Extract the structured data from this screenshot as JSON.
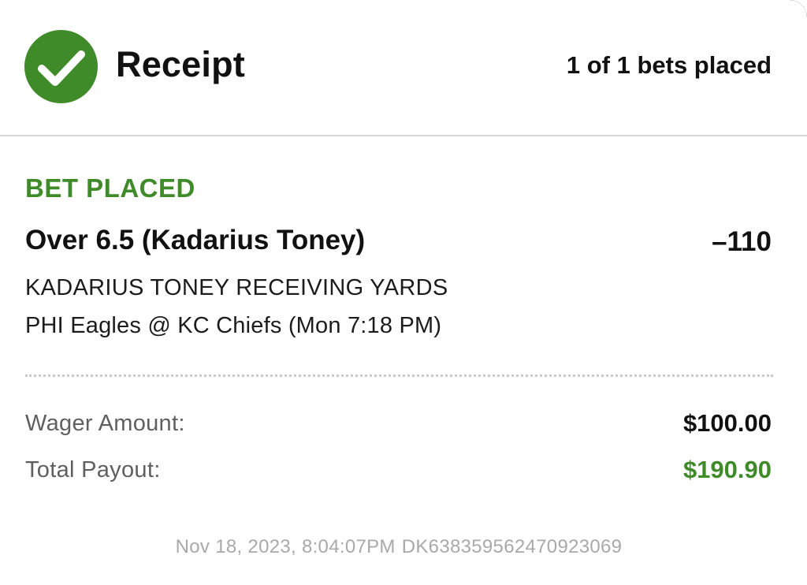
{
  "header": {
    "icon": "check-circle-icon",
    "title": "Receipt",
    "bets_placed": "1 of 1 bets placed"
  },
  "bet": {
    "status": "BET PLACED",
    "selection": "Over 6.5 (Kadarius Toney)",
    "odds": "–110",
    "market": "KADARIUS TONEY RECEIVING YARDS",
    "event": "PHI Eagles @ KC Chiefs (Mon 7:18 PM)"
  },
  "summary": {
    "wager_label": "Wager Amount:",
    "wager_value": "$100.00",
    "payout_label": "Total Payout:",
    "payout_value": "$190.90"
  },
  "footer": {
    "timestamp": "Nov 18, 2023, 8:04:07PM",
    "bet_id": "DK638359562470923069"
  },
  "colors": {
    "accent_green": "#3f8b2a",
    "text_primary": "#111111",
    "text_secondary": "#5f5f5f",
    "text_muted": "#a9a9a9"
  }
}
